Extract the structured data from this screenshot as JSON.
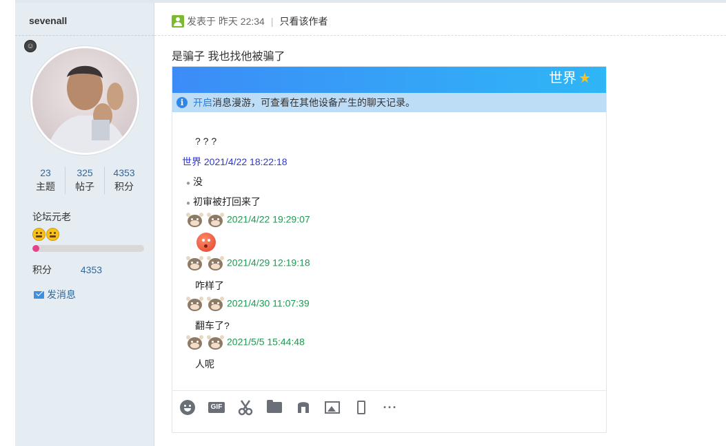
{
  "sidebar": {
    "username": "sevenall",
    "stats": [
      {
        "value": "23",
        "label": "主题"
      },
      {
        "value": "325",
        "label": "帖子"
      },
      {
        "value": "4353",
        "label": "积分"
      }
    ],
    "rank_title": "论坛元老",
    "level_progress_fraction": 0.06,
    "points_label": "积分",
    "points_value": "4353",
    "send_message_label": "发消息"
  },
  "post": {
    "posted_at": "发表于 昨天 22:34",
    "only_author_label": "只看该作者",
    "text": "是骗子 我也找他被骗了"
  },
  "chat": {
    "title": "世界",
    "notice_link": "开启",
    "notice_text": "消息漫游，可查看在其他设备产生的聊天记录。",
    "lines": {
      "l1": "? ? ?",
      "l2_name": "世界 2021/4/22 18:22:18",
      "l3": "没",
      "l4": "初审被打回来了",
      "t1": "2021/4/22 19:29:07",
      "t2": "2021/4/29 12:19:18",
      "m2": "咋样了",
      "t3": "2021/4/30 11:07:39",
      "m3": "翻车了?",
      "t4": "2021/5/5 15:44:48",
      "m4": "人呢"
    },
    "toolbar": [
      "emoji-icon",
      "gif-icon",
      "scissors-icon",
      "folder-icon",
      "music-icon",
      "image-icon",
      "shake-icon",
      "more-icon"
    ],
    "colors": {
      "header_start": "#3c8cf7",
      "header_end": "#2fb6f6",
      "notice_bg": "#bddcf6",
      "time_green": "#1b9a50",
      "name_blue": "#2b35d6"
    }
  }
}
